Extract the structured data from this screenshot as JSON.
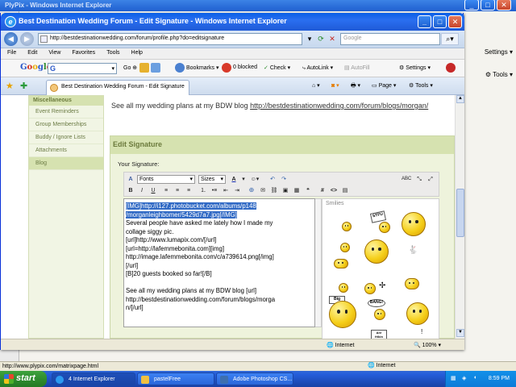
{
  "background_window": {
    "title": "PlyPix - Windows Internet Explorer",
    "go_label": "Go",
    "settings_label": "Settings",
    "tools_label": "Tools",
    "status_url": "http://www.plypix.com/matrixpage.html",
    "status_zone": "Internet"
  },
  "window": {
    "title": "Best Destination Wedding Forum - Edit Signature - Windows Internet Explorer",
    "controls": {
      "minimize": "_",
      "maximize": "□",
      "close": "✕"
    }
  },
  "address_bar": {
    "url": "http://bestdestinationwedding.com/forum/profile.php?do=editsignature",
    "search_placeholder": "Google"
  },
  "menu": [
    "File",
    "Edit",
    "View",
    "Favorites",
    "Tools",
    "Help"
  ],
  "google_toolbar": {
    "logo": "Google",
    "go_label": "Go",
    "bookmarks_label": "Bookmarks",
    "blocked_label": "0 blocked",
    "check_label": "Check",
    "autolink_label": "AutoLink",
    "autofill_label": "AutoFill",
    "settings_label": "Settings"
  },
  "tabs": {
    "active_tab": "Best Destination Wedding Forum - Edit Signature",
    "page_label": "Page",
    "tools_label": "Tools"
  },
  "sidebar": {
    "heading": "Miscellaneous",
    "items": [
      "Event Reminders",
      "Group Memberships",
      "Buddy / Ignore Lists",
      "Attachments",
      "Blog"
    ]
  },
  "preview": {
    "text": "See all my wedding plans at my BDW blog",
    "link": "http://bestdestinationwedding.com/forum/blogs/morgan/"
  },
  "editor": {
    "heading": "Edit Signature",
    "your_signature_label": "Your Signature:",
    "font_select": "Fonts",
    "size_select": "Sizes",
    "smilies_label": "Smilies",
    "selected_text": "[IMG]http://i127.photobucket.com/albums/p148\n/morganleighbomer/5429d7a7.jpg[/IMG]",
    "body_text": "\nSeveral people have asked me lately how I made my\ncollage siggy pic.\n[url]http://www.lumapix.com/[/url]\n[url=http://lafemmebonita.com][img]\nhttp://image.lafemmebonita.com/c/a739614.png[/img]\n[/url]\n[B]20 guests booked so far![/B]\n\nSee all my wedding plans at my BDW blog [url]\nhttp://bestdestinationwedding.com/forum/blogs/morga\nn/[/url]",
    "signs": {
      "stfu": "STFU",
      "big": "Big",
      "bang": "BANG!",
      "are": "Are\nfrikin"
    }
  },
  "statusbar": {
    "zone": "Internet",
    "zoom": "100%"
  },
  "taskbar": {
    "start_label": "start",
    "tasks": [
      "4 Internet Explorer",
      "pastelFree",
      "Adobe Photoshop CS..."
    ],
    "clock": "8:59 PM"
  }
}
